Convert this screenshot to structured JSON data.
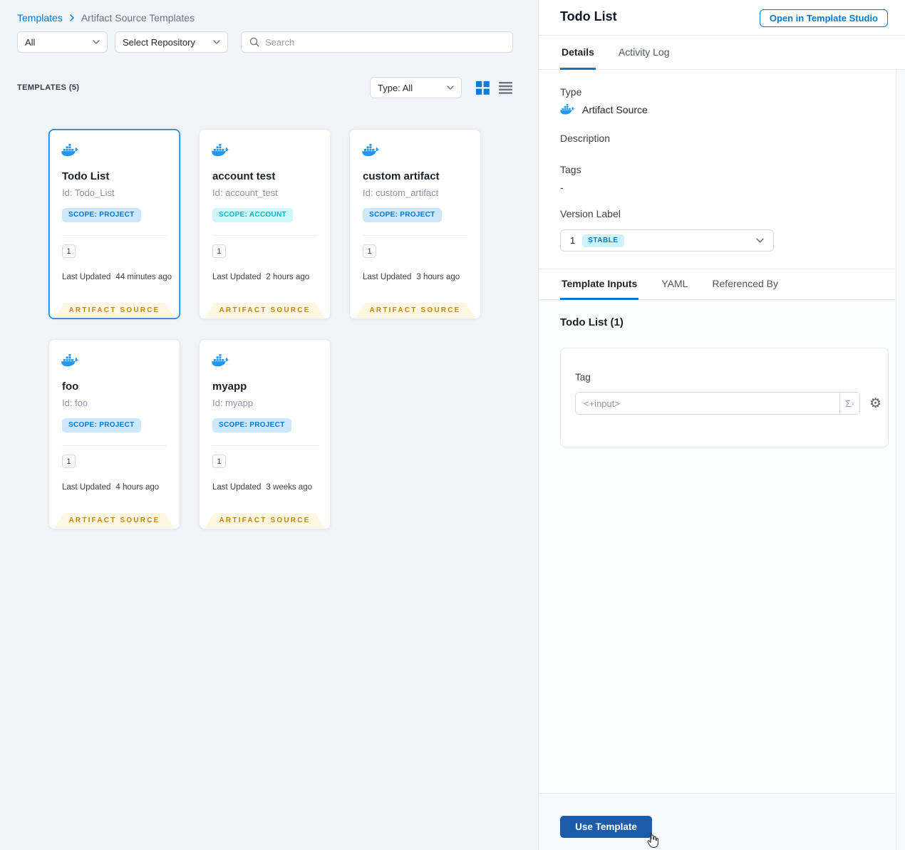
{
  "colors": {
    "accent_blue": "#0278d5",
    "docker_blue": "#2396ed",
    "primary_button": "#1a5cab",
    "scope_project_bg": "#cde7fe",
    "scope_account_bg": "#cdf6f9",
    "scope_account_text": "#0ab5c9",
    "stable_badge_bg": "#cdf4fe",
    "artifact_ribbon_bg": "#fff7e2",
    "artifact_ribbon_text": "#c8850c",
    "left_background": "#eff4f9"
  },
  "icons": {
    "gear": "⚙",
    "expression": "Σ",
    "expression_sub": "x"
  },
  "left": {
    "breadcrumb": {
      "link": "Templates",
      "current": "Artifact Source Templates"
    },
    "filters": {
      "scope": "All",
      "repository": "Select Repository",
      "search_placeholder": "Search"
    },
    "header": {
      "count": "TEMPLATES (5)",
      "type_filter": "Type: All"
    },
    "cards": [
      {
        "name": "Todo List",
        "id": "Id: Todo_List",
        "scope": "SCOPE: PROJECT",
        "versions": "1",
        "updated_label": "Last Updated",
        "updated": "44 minutes ago",
        "badge": "ARTIFACT SOURCE"
      },
      {
        "name": "account test",
        "id": "Id: account_test",
        "scope": "SCOPE: ACCOUNT",
        "versions": "1",
        "updated_label": "Last Updated",
        "updated": "2 hours ago",
        "badge": "ARTIFACT SOURCE"
      },
      {
        "name": "custom artifact",
        "id": "Id: custom_artifact",
        "scope": "SCOPE: PROJECT",
        "versions": "1",
        "updated_label": "Last Updated",
        "updated": "3 hours ago",
        "badge": "ARTIFACT SOURCE"
      },
      {
        "name": "foo",
        "id": "Id: foo",
        "scope": "SCOPE: PROJECT",
        "versions": "1",
        "updated_label": "Last Updated",
        "updated": "4 hours ago",
        "badge": "ARTIFACT SOURCE"
      },
      {
        "name": "myapp",
        "id": "Id: myapp",
        "scope": "SCOPE: PROJECT",
        "versions": "1",
        "updated_label": "Last Updated",
        "updated": "3 weeks ago",
        "badge": "ARTIFACT SOURCE"
      }
    ]
  },
  "panel": {
    "title": "Todo List",
    "open_button": "Open in Template Studio",
    "tabs": {
      "details": "Details",
      "activity": "Activity Log"
    },
    "details": {
      "type_label": "Type",
      "type_value": "Artifact Source",
      "description_label": "Description",
      "tags_label": "Tags",
      "tags_value": "-",
      "version_label": "Version Label",
      "version_value": "1",
      "version_badge": "STABLE"
    },
    "inner_tabs": {
      "inputs": "Template Inputs",
      "yaml": "YAML",
      "referenced": "Referenced By"
    },
    "inputs": {
      "heading": "Todo List (1)",
      "tag_label": "Tag",
      "tag_value": "<+input>"
    },
    "footer": {
      "use_template": "Use Template"
    }
  }
}
